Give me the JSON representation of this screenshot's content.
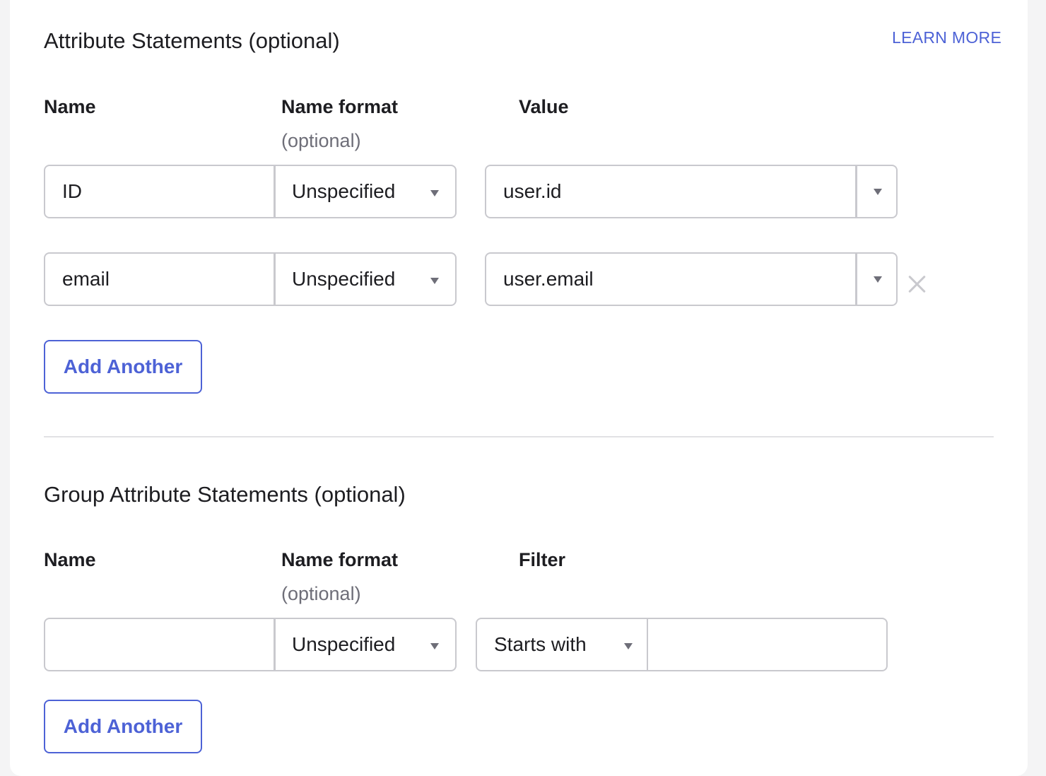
{
  "attribute_statements": {
    "title": "Attribute Statements (optional)",
    "learn_more": "LEARN MORE",
    "columns": {
      "name": "Name",
      "name_format": "Name format",
      "name_format_sub": "(optional)",
      "value": "Value"
    },
    "rows": [
      {
        "name": "ID",
        "name_format": "Unspecified",
        "value": "user.id"
      },
      {
        "name": "email",
        "name_format": "Unspecified",
        "value": "user.email"
      }
    ],
    "add_another": "Add Another"
  },
  "group_attribute_statements": {
    "title": "Group Attribute Statements (optional)",
    "columns": {
      "name": "Name",
      "name_format": "Name format",
      "name_format_sub": "(optional)",
      "filter": "Filter"
    },
    "rows": [
      {
        "name": "",
        "name_format": "Unspecified",
        "filter_type": "Starts with",
        "filter_value": ""
      }
    ],
    "add_another": "Add Another"
  },
  "colors": {
    "accent": "#4d62d6",
    "border": "#c9c9ce",
    "text": "#1d1d21",
    "muted": "#6e6e78"
  }
}
